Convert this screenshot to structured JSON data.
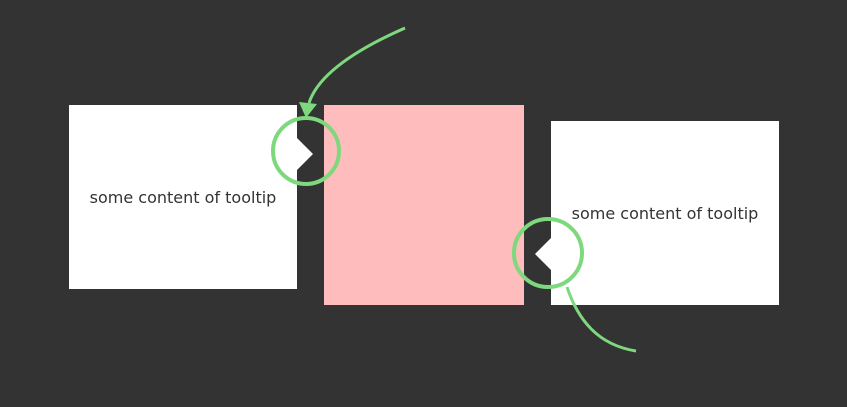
{
  "tooltips": [
    {
      "text": "some content of tooltip",
      "arrow_side": "right"
    },
    {
      "text": "some content of tooltip",
      "arrow_side": "left"
    }
  ],
  "colors": {
    "background": "#333333",
    "tooltip": "#ffffff",
    "target": "#ffbcbc",
    "annotation": "#7ed87e"
  }
}
